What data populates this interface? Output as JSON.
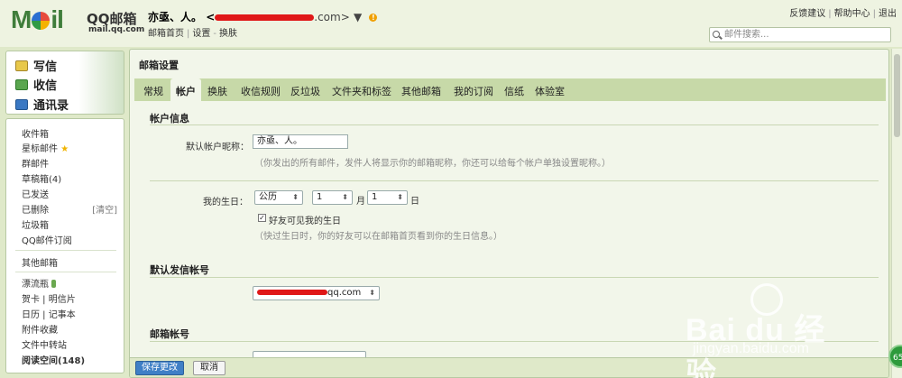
{
  "header": {
    "logo_text": "M  il",
    "logo_brand": "QQ邮箱",
    "logo_url": "mail.qq.com",
    "user_name": "亦亟、人。",
    "user_email_suffix": ".com>",
    "user_dropdown": "▼",
    "links": [
      "邮箱首页",
      "设置",
      "换肤"
    ],
    "top_links": [
      "反馈建议",
      "帮助中心",
      "退出"
    ],
    "search_placeholder": "邮件搜索..."
  },
  "sidebar": {
    "primary": [
      {
        "label": "写信",
        "icon": "write-icon"
      },
      {
        "label": "收信",
        "icon": "inbox-icon"
      },
      {
        "label": "通讯录",
        "icon": "contacts-icon"
      }
    ],
    "folders": [
      {
        "label": "收件箱"
      },
      {
        "label": "星标邮件",
        "suffix": "★"
      },
      {
        "label": "群邮件"
      },
      {
        "label": "草稿箱(4)"
      },
      {
        "label": "已发送"
      },
      {
        "label": "已删除",
        "action": "[清空]"
      },
      {
        "label": "垃圾箱"
      },
      {
        "label": "QQ邮件订阅"
      }
    ],
    "other": [
      {
        "label": "其他邮箱"
      }
    ],
    "apps": [
      {
        "label": "漂流瓶"
      },
      {
        "label": "贺卡 | 明信片"
      },
      {
        "label": "日历 | 记事本"
      },
      {
        "label": "附件收藏"
      },
      {
        "label": "文件中转站"
      },
      {
        "label": "阅读空间(148)"
      }
    ]
  },
  "main": {
    "title": "邮箱设置",
    "tabs": [
      "常规",
      "帐户",
      "换肤",
      "收信规则",
      "反垃圾",
      "文件夹和标签",
      "其他邮箱",
      "我的订阅",
      "信纸",
      "体验室"
    ],
    "active_tab": "帐户",
    "account_info": {
      "section_title": "帐户信息",
      "nickname_label": "默认帐户昵称：",
      "nickname_value": "亦亟、人。",
      "nickname_hint": "（你发出的所有邮件，发件人将显示你的邮箱昵称，你还可以给每个帐户单独设置昵称。）",
      "birthday_label": "我的生日：",
      "calendar_type": "公历",
      "month": "1",
      "month_unit": "月",
      "day": "1",
      "day_unit": "日",
      "birthday_visible_checked": true,
      "birthday_visible_label": "好友可见我的生日",
      "birthday_hint": "（快过生日时，你的好友可以在邮箱首页看到你的生日信息。）"
    },
    "default_sender": {
      "section_title": "默认发信帐号",
      "value_suffix": "qq.com"
    },
    "mail_account": {
      "section_title": "邮箱帐号"
    },
    "buttons": {
      "save": "保存更改",
      "cancel": "取消"
    }
  },
  "badge": "65",
  "watermark": {
    "line1": "Bai du 经验",
    "line2": "jingyan.baidu.com"
  },
  "colors": {
    "accent_green": "#3f7d3a",
    "tab_bar": "#c7d9a8",
    "panel_bg": "#f2f6ea",
    "save_button": "#3f7fc6",
    "redaction": "#e01818"
  }
}
